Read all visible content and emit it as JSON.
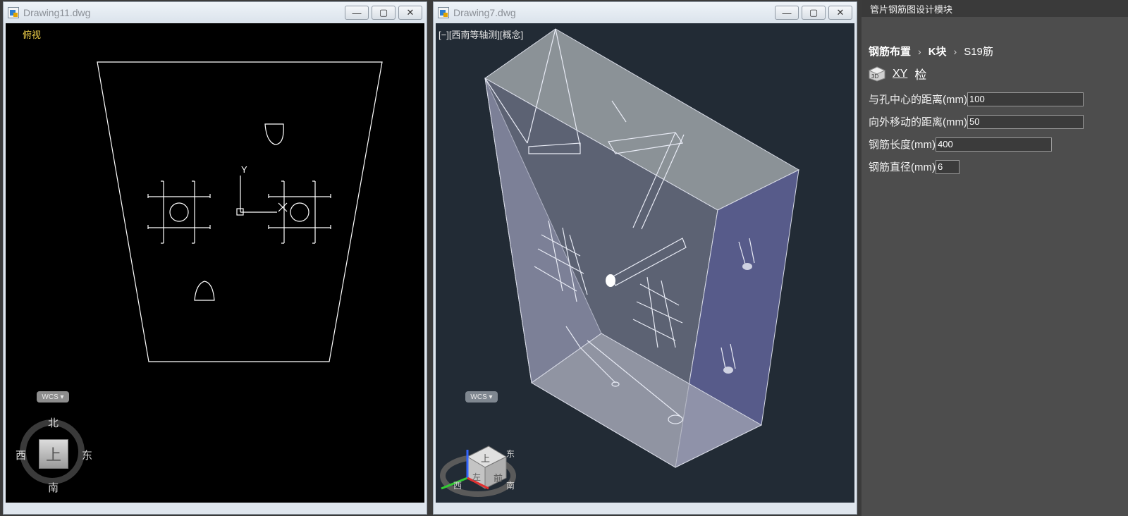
{
  "windows": {
    "left": {
      "title": "Drawing11.dwg",
      "view_label": "俯视",
      "wcs": "WCS ▾",
      "compass": {
        "n": "北",
        "s": "南",
        "w": "西",
        "e": "东",
        "center": "上"
      },
      "ucs_y": "Y"
    },
    "mid": {
      "title": "Drawing7.dwg",
      "view_label": "[−][西南等轴测][概念]",
      "wcs": "WCS ▾",
      "cube": {
        "face_top": "上",
        "face_front": "前",
        "face_left": "左",
        "south": "南",
        "west": "西",
        "east": "东"
      }
    },
    "buttons": {
      "minimize": "—",
      "maximize": "▢",
      "close": "✕"
    }
  },
  "panel": {
    "header": "管片钢筋图设计模块",
    "breadcrumb": [
      "钢筋布置",
      "K块",
      "S19筋"
    ],
    "breadcrumb_sep": "›",
    "tools": {
      "xy": "XY",
      "check": "检"
    },
    "fields": [
      {
        "label": "与孔中心的距离(mm)",
        "value": "100"
      },
      {
        "label": "向外移动的距离(mm)",
        "value": "50"
      },
      {
        "label": "钢筋长度(mm)",
        "value": "400"
      },
      {
        "label": "钢筋直径(mm)",
        "value": "6"
      }
    ]
  }
}
